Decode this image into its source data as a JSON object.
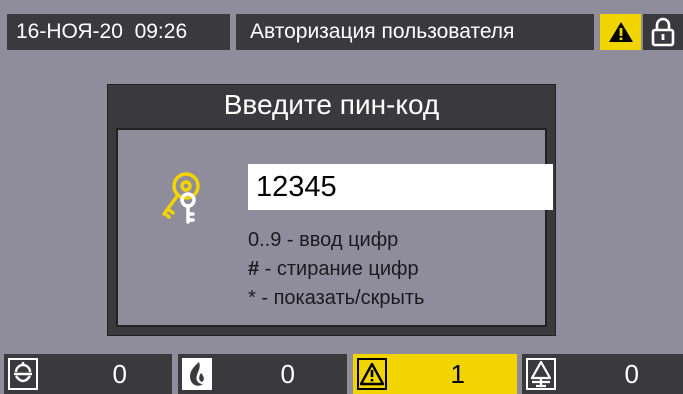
{
  "header": {
    "datetime": "16-НОЯ-20  09:26",
    "title": "Авторизация пользователя",
    "warning_icon": "warning-icon",
    "lock_icon": "unlocked-icon",
    "warning_color": "#f2d400"
  },
  "dialog": {
    "title": "Введите пин-код",
    "pin_value": "12345",
    "key_icon": "key-icon",
    "hints": [
      {
        "key": "0..9",
        "text": " - ввод цифр"
      },
      {
        "key": "#",
        "text": " - стирание цифр"
      },
      {
        "key": "*",
        "text": " - показать/скрыть"
      }
    ]
  },
  "status_bar": [
    {
      "icon": "alarm-bell-icon",
      "count": "0",
      "active": false
    },
    {
      "icon": "fire-icon",
      "count": "0",
      "active": false
    },
    {
      "icon": "warning-icon",
      "count": "1",
      "active": true
    },
    {
      "icon": "fault-icon",
      "count": "0",
      "active": false
    }
  ]
}
